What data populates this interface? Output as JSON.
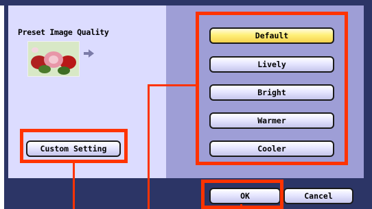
{
  "left_panel": {
    "title": "Preset Image Quality"
  },
  "quality_options": [
    {
      "label": "Default",
      "selected": true
    },
    {
      "label": "Lively",
      "selected": false
    },
    {
      "label": "Bright",
      "selected": false
    },
    {
      "label": "Warmer",
      "selected": false
    },
    {
      "label": "Cooler",
      "selected": false
    }
  ],
  "buttons": {
    "custom_setting": "Custom Setting",
    "ok": "OK",
    "cancel": "Cancel"
  },
  "colors": {
    "highlight": "#ff3300",
    "selected_button": "#fff07a",
    "panel_right": "#9e9ed6",
    "panel_left": "#dcdcff",
    "bottom_bar": "#2c3566"
  },
  "icons": {
    "thumbnail": "preset-image-thumbnail",
    "arrow": "arrow-right-icon"
  }
}
